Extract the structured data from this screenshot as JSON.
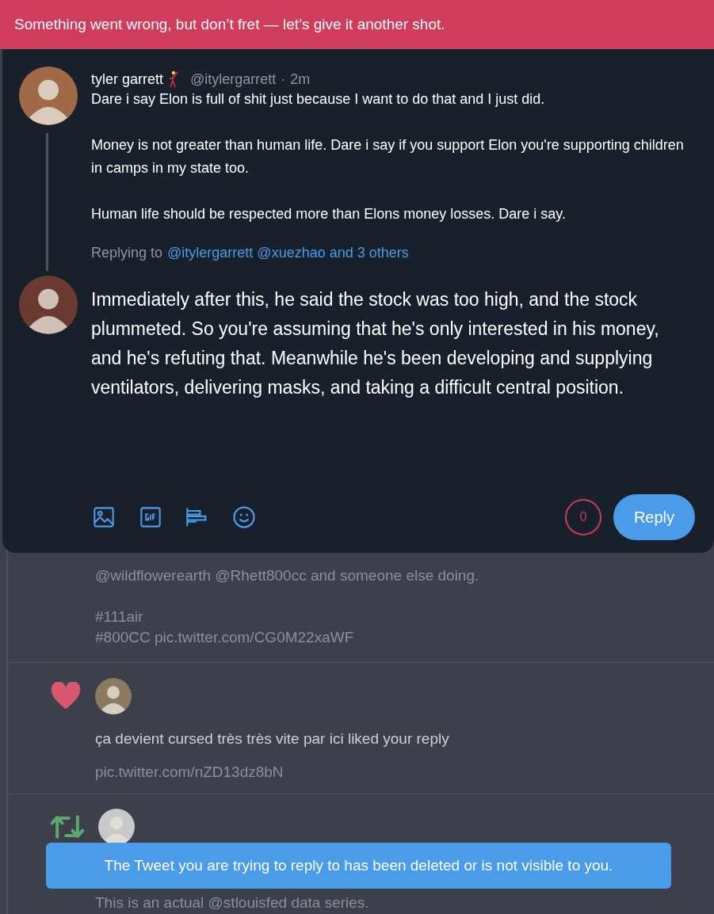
{
  "error_banner": {
    "text": "Something went wrong, but don’t fret — let’s give it another shot."
  },
  "reply_modal": {
    "original_tweet": {
      "author_name": "tyler garrett",
      "handle": "@itylergarrett",
      "separator": "·",
      "time": "2m",
      "paragraphs": [
        "Dare i say Elon is full of shit just because I want to do that and I just did.",
        "Money is not greater than human life. Dare i say if you support Elon you're supporting children in camps in my state too.",
        "Human life should be respected more than Elons money losses. Dare i say."
      ],
      "replying_label": "Replying to",
      "replying_mentions": "@itylergarrett @xuezhao and 3 others"
    },
    "draft_text": "Immediately after this, he said the stock was too high, and the stock plummeted. So you're assuming that he's only interested in his money, and he's refuting that. Meanwhile he's been developing and supplying ventilators, delivering masks, and taking a difficult central position.",
    "char_counter": "0",
    "reply_button": "Reply"
  },
  "timeline": [
    {
      "kind": "tail",
      "paragraphs": [
        "@wildflowerearth @Rhett800cc and someone else doing.",
        "#111air\n#800CC pic.twitter.com/CG0M22xaWF"
      ]
    },
    {
      "kind": "like",
      "text": "ça devient cursed très très vite par ici liked your reply",
      "link": "pic.twitter.com/nZD13dz8bN"
    },
    {
      "kind": "retweet",
      "text": "This is an actual @stlouisfed data series."
    }
  ],
  "toast": {
    "text": "The Tweet you are trying to reply to has been deleted or is not visible to you."
  }
}
